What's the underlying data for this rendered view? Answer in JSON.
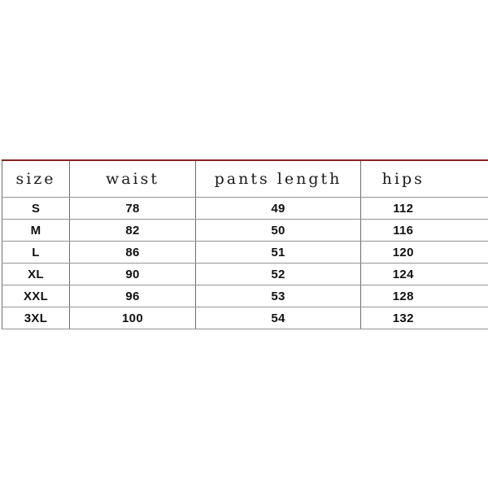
{
  "chart_data": {
    "type": "table",
    "title": "",
    "columns": [
      "size",
      "waist",
      "pants length",
      "hips"
    ],
    "rows": [
      [
        "S",
        "78",
        "49",
        "112"
      ],
      [
        "M",
        "82",
        "50",
        "116"
      ],
      [
        "L",
        "86",
        "51",
        "120"
      ],
      [
        "XL",
        "90",
        "52",
        "124"
      ],
      [
        "XXL",
        "96",
        "53",
        "128"
      ],
      [
        "3XL",
        "100",
        "54",
        "132"
      ]
    ]
  },
  "table": {
    "headers": {
      "size": "size",
      "waist": "waist",
      "pants_length": "pants length",
      "hips": "hips"
    },
    "rows": [
      {
        "size": "S",
        "waist": "78",
        "pants_length": "49",
        "hips": "112"
      },
      {
        "size": "M",
        "waist": "82",
        "pants_length": "50",
        "hips": "116"
      },
      {
        "size": "L",
        "waist": "86",
        "pants_length": "51",
        "hips": "120"
      },
      {
        "size": "XL",
        "waist": "90",
        "pants_length": "52",
        "hips": "124"
      },
      {
        "size": "XXL",
        "waist": "96",
        "pants_length": "53",
        "hips": "128"
      },
      {
        "size": "3XL",
        "waist": "100",
        "pants_length": "54",
        "hips": "132"
      }
    ]
  },
  "colors": {
    "top_rule": "#8b2220",
    "grid_line": "#949494",
    "divider_line": "#6e6e6e",
    "background": "#ffffff",
    "text": "#111111"
  }
}
